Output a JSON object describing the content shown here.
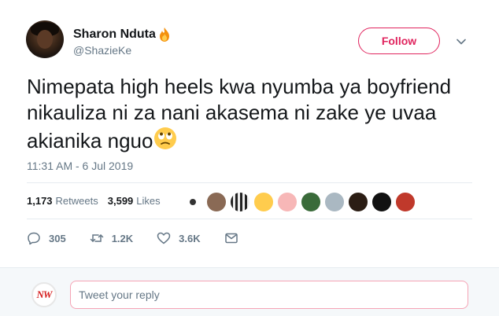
{
  "user": {
    "display_name": "Sharon Nduta",
    "handle": "@ShazieKe"
  },
  "follow_label": "Follow",
  "tweet_text": "Nimepata high heels kwa  nyumba ya boyfriend nikauliza ni za nani akasema ni zake ye uvaa akianika nguo",
  "timestamp": "11:31 AM - 6 Jul 2019",
  "stats": {
    "retweets_count": "1,173",
    "retweets_label": "Retweets",
    "likes_count": "3,599",
    "likes_label": "Likes"
  },
  "actions": {
    "replies": "305",
    "retweets": "1.2K",
    "likes": "3.6K"
  },
  "reply": {
    "logo_text": "NW",
    "placeholder": "Tweet your reply"
  },
  "icons": [
    "fire-emoji-icon",
    "chevron-down-icon",
    "eye-roll-emoji-icon",
    "reply-icon",
    "retweet-icon",
    "heart-icon",
    "message-icon"
  ],
  "colors": {
    "accent": "#e0245e",
    "secondary_text": "#657786",
    "divider": "#e6ecf0"
  }
}
